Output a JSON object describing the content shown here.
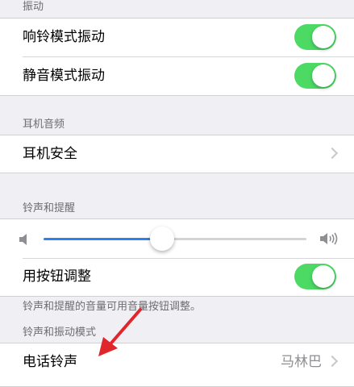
{
  "vibration": {
    "header": "振动",
    "ring_label": "响铃模式振动",
    "silent_label": "静音模式振动",
    "ring_on": true,
    "silent_on": true
  },
  "headphone": {
    "header": "耳机音频",
    "safety_label": "耳机安全"
  },
  "ringer": {
    "header": "铃声和提醒",
    "volume_level": 0.45,
    "change_with_buttons_label": "用按钮调整",
    "change_with_buttons_on": true,
    "footer": "铃声和提醒的音量可用音量按钮调整。"
  },
  "sounds": {
    "header": "铃声和振动模式",
    "ringtone_label": "电话铃声",
    "ringtone_value": "马林巴"
  },
  "colors": {
    "toggle_on": "#4cd964",
    "slider_fill": "#2f7ff0",
    "annotation_arrow": "#e0262a"
  },
  "icons": {
    "volume_low": "speaker-low-icon",
    "volume_high": "speaker-high-icon",
    "chevron": "chevron-right-icon",
    "annotation": "red-arrow-annotation"
  }
}
